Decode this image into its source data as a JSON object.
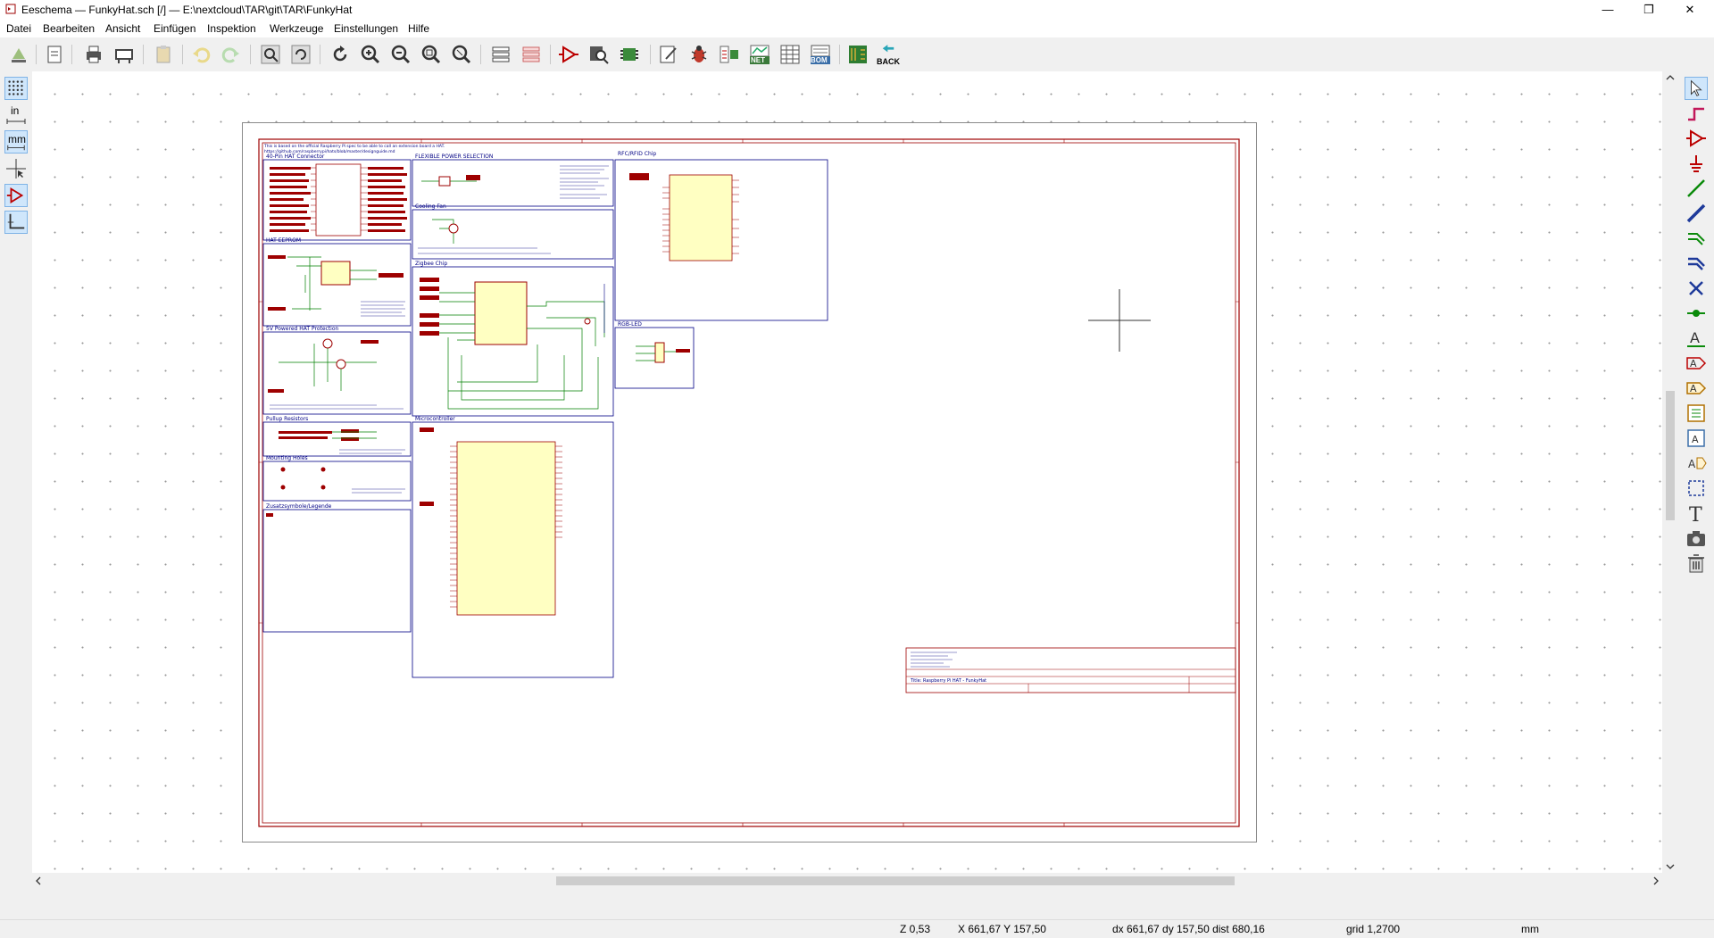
{
  "window": {
    "title": "Eeschema — FunkyHat.sch [/] — E:\\nextcloud\\TAR\\git\\TAR\\FunkyHat",
    "minimize": "—",
    "restore": "❐",
    "close": "✕"
  },
  "menu": [
    "Datei",
    "Bearbeiten",
    "Ansicht",
    "Einfügen",
    "Inspektion",
    "Werkzeuge",
    "Einstellungen",
    "Hilfe"
  ],
  "toolbar": {
    "back_label": "BACK",
    "net_label": "NET",
    "bom_label": "BOM"
  },
  "left_toolbar": {
    "units_in": "in",
    "units_mm": "mm"
  },
  "schematic": {
    "header_note": "This is based on the official Raspberry Pi spec to be able to call an extension board a HAT.",
    "header_link": "https://github.com/raspberrypi/hats/blob/master/designguide.md",
    "blocks": [
      {
        "key": "gpio",
        "title": "40-Pin HAT Connector"
      },
      {
        "key": "power",
        "title": "FLEXIBLE POWER SELECTION"
      },
      {
        "key": "rfid",
        "title": "RFC/RFID Chip"
      },
      {
        "key": "eeprom",
        "title": "HAT EEPROM"
      },
      {
        "key": "fan",
        "title": "Cooling Fan"
      },
      {
        "key": "zigbee",
        "title": "Zigbee Chip"
      },
      {
        "key": "rgb",
        "title": "RGB-LED"
      },
      {
        "key": "protect",
        "title": "5V Powered HAT Protection"
      },
      {
        "key": "pullup",
        "title": "Pullup Resistors"
      },
      {
        "key": "holes",
        "title": "Mounting Holes"
      },
      {
        "key": "legend",
        "title": "Zusatzsymbole/Legende"
      },
      {
        "key": "mcu",
        "title": "Microcontroller"
      }
    ],
    "titleblock": {
      "title": "Title: Raspberry Pi HAT - FunkyHat"
    }
  },
  "status": {
    "zoom": "Z 0,53",
    "xy": "X 661,67  Y 157,50",
    "delta": "dx 661,67  dy 157,50  dist 680,16",
    "grid": "grid 1,2700",
    "units": "mm"
  },
  "colors": {
    "schematic_border": "#9e0000",
    "wire": "#008000",
    "sheet_box": "#000084",
    "component_fill": "#ffffc2"
  }
}
